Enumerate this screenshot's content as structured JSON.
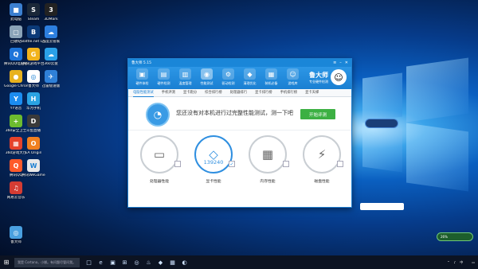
{
  "desktop_icons": [
    {
      "label": "此电脑",
      "color": "#3b7fd0",
      "glyph": "■"
    },
    {
      "label": "Steam",
      "color": "#1b2838",
      "glyph": "S"
    },
    {
      "label": "3DMark",
      "color": "#222222",
      "glyph": "3"
    },
    {
      "label": "回收站",
      "color": "#8aa3b8",
      "glyph": "▢"
    },
    {
      "label": "Battle.net Launcher",
      "color": "#0b3a78",
      "glyph": "B"
    },
    {
      "label": "百度云管家",
      "color": "#2d7fe0",
      "glyph": "☁"
    },
    {
      "label": "腾讯QQ电脑管家",
      "color": "#1d74d9",
      "glyph": "Q"
    },
    {
      "label": "腾讯游戏平台",
      "color": "#f2b31b",
      "glyph": "G"
    },
    {
      "label": "360云盘",
      "color": "#2aa0e8",
      "glyph": "☁"
    },
    {
      "label": "Google Chrome",
      "color": "#e8b21e",
      "glyph": "●"
    },
    {
      "label": "鲁大师",
      "color": "#ffffff",
      "glyph": "◎"
    },
    {
      "label": "迅雷极速版",
      "color": "#2f80d8",
      "glyph": "✈"
    },
    {
      "label": "YY语音",
      "color": "#1b8cf0",
      "glyph": "Y"
    },
    {
      "label": "华为手机",
      "color": "#2aa3e3",
      "glyph": "H"
    },
    {
      "label": "360安全卫士",
      "color": "#6dbb2f",
      "glyph": "+"
    },
    {
      "label": "斗鱼直播",
      "color": "#3a3a3a",
      "glyph": "D"
    },
    {
      "label": "360游戏大厅",
      "color": "#e5432b",
      "glyph": "▦"
    },
    {
      "label": "EA Origin",
      "color": "#f08020",
      "glyph": "O"
    },
    {
      "label": "腾讯QQ",
      "color": "#ff5a2a",
      "glyph": "Q"
    },
    {
      "label": "腾讯WeGame",
      "color": "#e8e8e8",
      "glyph": "W"
    },
    {
      "label": "网易云音乐",
      "color": "#d43c33",
      "glyph": "♫"
    },
    {
      "label": "鲁大师",
      "color": "#4aa0e0",
      "glyph": "◎"
    }
  ],
  "window": {
    "title": "鲁大师 5.15",
    "toolbar": [
      {
        "label": "硬件体检",
        "glyph": "▣"
      },
      {
        "label": "硬件检测",
        "glyph": "▤"
      },
      {
        "label": "温度管理",
        "glyph": "▥"
      },
      {
        "label": "性能测试",
        "glyph": "◉"
      },
      {
        "label": "驱动检测",
        "glyph": "⚙"
      },
      {
        "label": "清理优化",
        "glyph": "◆"
      },
      {
        "label": "装机必备",
        "glyph": "▦"
      },
      {
        "label": "游戏库",
        "glyph": "☺"
      }
    ],
    "brand_name": "鲁大师",
    "brand_sub": "专业硬件检测",
    "subtabs": [
      "电脑性能测试",
      "手机评测",
      "显卡跑分",
      "综合排行榜",
      "处理器排行",
      "显卡排行榜",
      "手机排行榜",
      "显卡天梯"
    ],
    "hero_title": "您还没有对本机进行过完整性能测试，测一下吧",
    "hero_sub": "",
    "start_button": "开始评测",
    "cards": [
      {
        "label": "处理器性能",
        "glyph": "▭",
        "score": "",
        "checked": false
      },
      {
        "label": "显卡性能",
        "glyph": "◇",
        "score": "139240",
        "checked": true
      },
      {
        "label": "内存性能",
        "glyph": "▦",
        "score": "",
        "checked": false
      },
      {
        "label": "磁盘性能",
        "glyph": "⚡",
        "score": "",
        "checked": false
      }
    ],
    "card_subtext": "",
    "progress_label": ""
  },
  "widgets": {
    "temp_bubble": "",
    "bottom_bubble": "26%"
  },
  "taskbar": {
    "search_placeholder": "我是 Cortana，小娜。有问题尽管问我。",
    "lang": "中",
    "time": "",
    "date": "",
    "apps": [
      "□",
      "e",
      "▣",
      "⊞",
      "◎",
      "♨",
      "◆",
      "▦",
      "◐"
    ]
  }
}
